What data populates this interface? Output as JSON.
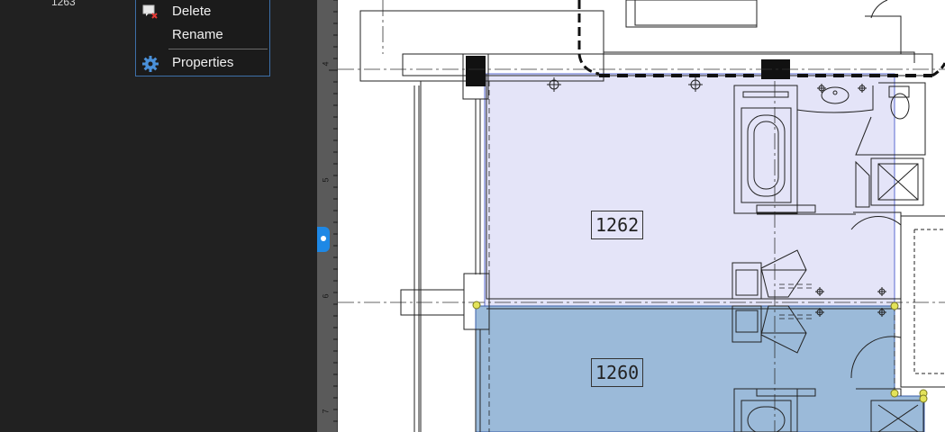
{
  "tree": {
    "partial_item": "1263"
  },
  "context_menu": {
    "items": [
      {
        "label": "Delete",
        "icon": "delete-icon"
      },
      {
        "label": "Rename",
        "icon": ""
      },
      {
        "label": "Properties",
        "icon": "gear-icon"
      }
    ]
  },
  "ruler": {
    "labels": [
      "4",
      "5",
      "6",
      "7"
    ]
  },
  "floorplan": {
    "rooms": [
      {
        "label": "1262",
        "fill": "#e4e4f8"
      },
      {
        "label": "1260",
        "fill": "#9bbad9"
      }
    ]
  },
  "colors": {
    "accent": "#1e88e5",
    "menu_border": "#3d6fa8",
    "vertex_handle": "#e3e35a"
  }
}
